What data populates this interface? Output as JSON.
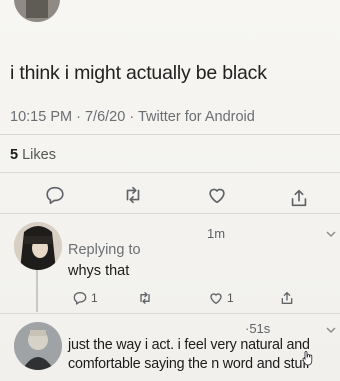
{
  "tweet": {
    "text": "i think i might actually be black",
    "time": "10:15 PM",
    "date": "7/6/20",
    "separator": "·",
    "source": "Twitter for Android",
    "likes_count": "5",
    "likes_label": "Likes"
  },
  "actions": {
    "icons": [
      "reply-icon",
      "retweet-icon",
      "like-icon",
      "share-icon"
    ]
  },
  "reply1": {
    "time": "1m",
    "replying_to": "Replying to",
    "text": "whys that",
    "reply_count": "1",
    "like_count": "1"
  },
  "reply2": {
    "time": "·51s",
    "line1": "just the way i act. i feel very natural and",
    "line2": "comfortable saying the n word and stuff"
  },
  "colors": {
    "icon_gray": "#6b6f74",
    "text_dark": "#1c1c1c",
    "meta_gray": "#6a6e73"
  }
}
